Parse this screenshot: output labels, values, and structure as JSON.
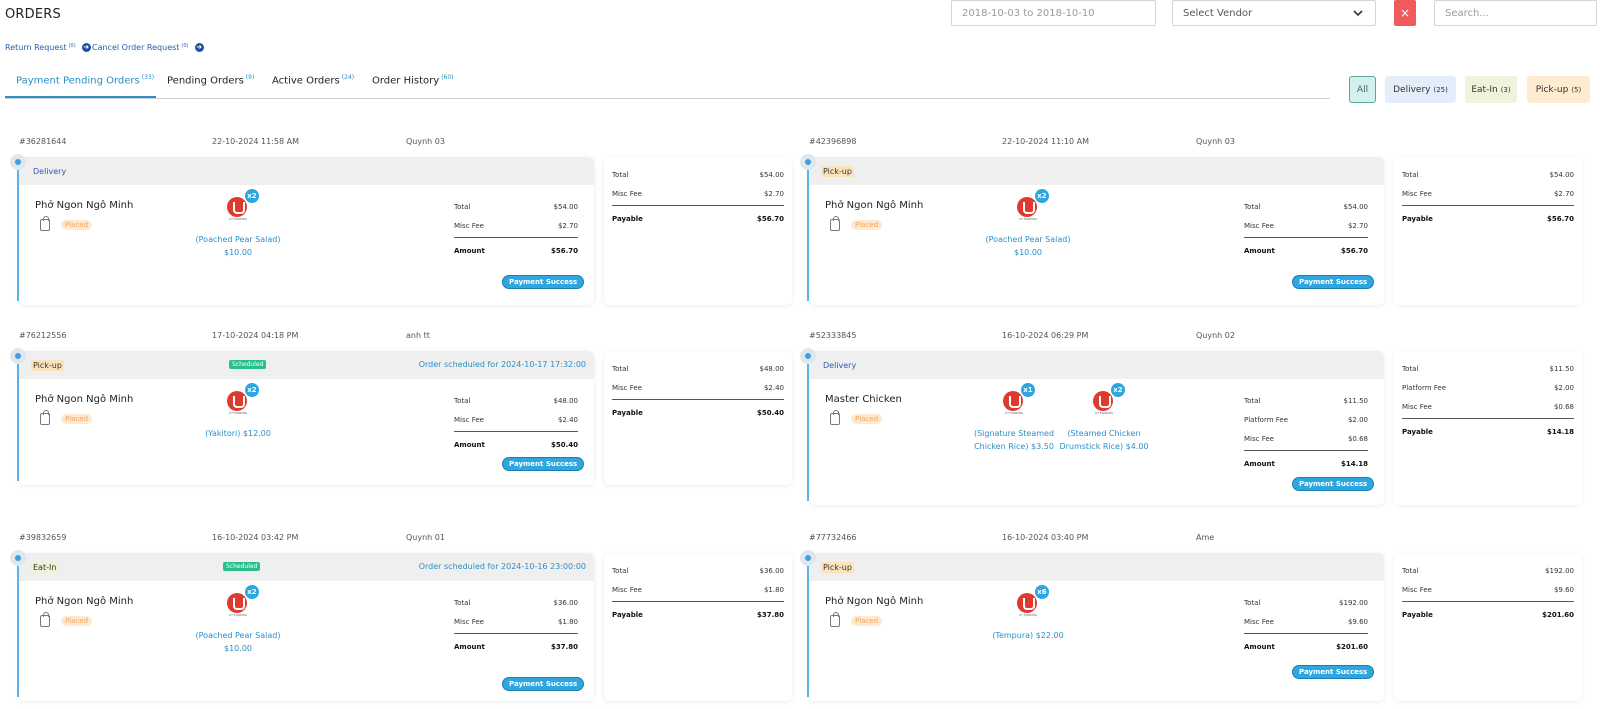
{
  "header": {
    "title": "ORDERS",
    "date_range": "2018-10-03 to 2018-10-10",
    "vendor_select": "Select Vendor",
    "clear_label": "×",
    "search_placeholder": "Search..."
  },
  "requests": {
    "return_label": "Return Request",
    "return_count": "(0)",
    "cancel_label": "Cancel Order Request",
    "cancel_count": "(0)"
  },
  "tabs": [
    {
      "label": "Payment Pending Orders",
      "count": "(33)",
      "active": true
    },
    {
      "label": "Pending Orders",
      "count": "(9)"
    },
    {
      "label": "Active Orders",
      "count": "(24)"
    },
    {
      "label": "Order History",
      "count": "(60)"
    }
  ],
  "filters": {
    "all": "All",
    "delivery": "Delivery",
    "delivery_count": "(25)",
    "eatin": "Eat-In",
    "eatin_count": "(3)",
    "pickup": "Pick-up",
    "pickup_count": "(5)"
  },
  "common": {
    "placed": "Placed",
    "payment_success": "Payment Success",
    "brand": "CT FOODHA",
    "scheduled": "Scheduled",
    "total": "Total",
    "misc_fee": "Misc Fee",
    "platform_fee": "Platform Fee",
    "amount": "Amount",
    "payable": "Payable"
  },
  "orders": [
    {
      "id": "#36281644",
      "date": "22-10-2024 11:58 AM",
      "customer": "Quynh 03",
      "type": "Delivery",
      "vendor": "Phở Ngon Ngô Minh",
      "items": [
        {
          "qty": "x2",
          "name": "(Poached Pear Salad)",
          "price": "$10.00"
        }
      ],
      "total": "$54.00",
      "misc": "$2.70",
      "amount": "$56.70",
      "payable": "$56.70"
    },
    {
      "id": "#42396898",
      "date": "22-10-2024 11:10 AM",
      "customer": "Quynh 03",
      "type": "Pick-up",
      "vendor": "Phở Ngon Ngô Minh",
      "items": [
        {
          "qty": "x2",
          "name": "(Poached Pear Salad)",
          "price": "$10.00"
        }
      ],
      "total": "$54.00",
      "misc": "$2.70",
      "amount": "$56.70",
      "payable": "$56.70"
    },
    {
      "id": "#76212556",
      "date": "17-10-2024 04:18 PM",
      "customer": "anh tt",
      "type": "Pick-up",
      "vendor": "Phở Ngon Ngô Minh",
      "schedule": "Order scheduled for 2024-10-17 17:32:00",
      "items": [
        {
          "qty": "x2",
          "name": "(Yakitori) $12.00"
        }
      ],
      "total": "$48.00",
      "misc": "$2.40",
      "amount": "$50.40",
      "payable": "$50.40"
    },
    {
      "id": "#52333845",
      "date": "16-10-2024 06:29 PM",
      "customer": "Quynh 02",
      "type": "Delivery",
      "vendor": "Master Chicken",
      "items": [
        {
          "qty": "x1",
          "name": "(Signature Steamed",
          "name2": "Chicken Rice) $3.50"
        },
        {
          "qty": "x2",
          "name": "(Steamed Chicken",
          "name2": "Drumstick Rice) $4.00"
        }
      ],
      "total": "$11.50",
      "platform": "$2.00",
      "misc": "$0.68",
      "amount": "$14.18",
      "payable": "$14.18"
    },
    {
      "id": "#39832659",
      "date": "16-10-2024 03:42 PM",
      "customer": "Quynh 01",
      "type": "Eat-In",
      "vendor": "Phở Ngon Ngô Minh",
      "schedule": "Order scheduled for 2024-10-16 23:00:00",
      "items": [
        {
          "qty": "x2",
          "name": "(Poached Pear Salad)",
          "price": "$10.00"
        }
      ],
      "total": "$36.00",
      "misc": "$1.80",
      "amount": "$37.80",
      "payable": "$37.80"
    },
    {
      "id": "#77732466",
      "date": "16-10-2024 03:40 PM",
      "customer": "Ame",
      "type": "Pick-up",
      "vendor": "Phở Ngon Ngô Minh",
      "items": [
        {
          "qty": "x6",
          "name": "(Tempura) $22.00"
        }
      ],
      "total": "$192.00",
      "misc": "$9.60",
      "amount": "$201.60",
      "payable": "$201.60"
    }
  ]
}
